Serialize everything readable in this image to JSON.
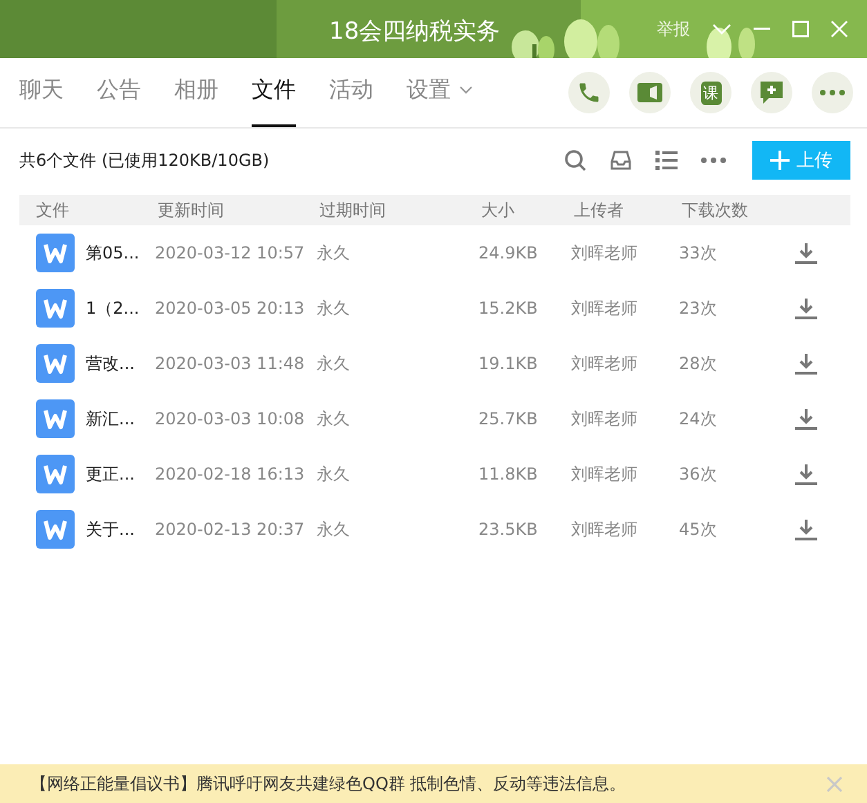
{
  "window": {
    "title": "18会四纳税实务",
    "report": "举报"
  },
  "tabs": [
    {
      "label": "聊天",
      "selected": false
    },
    {
      "label": "公告",
      "selected": false
    },
    {
      "label": "相册",
      "selected": false
    },
    {
      "label": "文件",
      "selected": true
    },
    {
      "label": "活动",
      "selected": false
    },
    {
      "label": "设置",
      "selected": false,
      "dropdown": true
    }
  ],
  "actions": [
    {
      "kind": "phone"
    },
    {
      "kind": "video"
    },
    {
      "kind": "text",
      "label": "课"
    },
    {
      "kind": "chat"
    },
    {
      "kind": "more"
    }
  ],
  "summary": "共6个文件 (已使用120KB/10GB)",
  "upload_button": "上传",
  "table": {
    "columns": [
      "文件",
      "更新时间",
      "过期时间",
      "大小",
      "上传者",
      "下载次数"
    ],
    "rows": [
      {
        "name": "第05...",
        "updated": "2020-03-12 10:57",
        "expires": "永久",
        "size": "24.9KB",
        "uploader": "刘晖老师",
        "downloads": "33次"
      },
      {
        "name": "1（2...",
        "updated": "2020-03-05 20:13",
        "expires": "永久",
        "size": "15.2KB",
        "uploader": "刘晖老师",
        "downloads": "23次"
      },
      {
        "name": "营改...",
        "updated": "2020-03-03 11:48",
        "expires": "永久",
        "size": "19.1KB",
        "uploader": "刘晖老师",
        "downloads": "28次"
      },
      {
        "name": "新汇...",
        "updated": "2020-03-03 10:08",
        "expires": "永久",
        "size": "25.7KB",
        "uploader": "刘晖老师",
        "downloads": "24次"
      },
      {
        "name": "更正...",
        "updated": "2020-02-18 16:13",
        "expires": "永久",
        "size": "11.8KB",
        "uploader": "刘晖老师",
        "downloads": "36次"
      },
      {
        "name": "关于...",
        "updated": "2020-02-13 20:37",
        "expires": "永久",
        "size": "23.5KB",
        "uploader": "刘晖老师",
        "downloads": "45次"
      }
    ]
  },
  "notice": "【网络正能量倡议书】腾讯呼吁网友共建绿色QQ群 抵制色情、反动等违法信息。"
}
